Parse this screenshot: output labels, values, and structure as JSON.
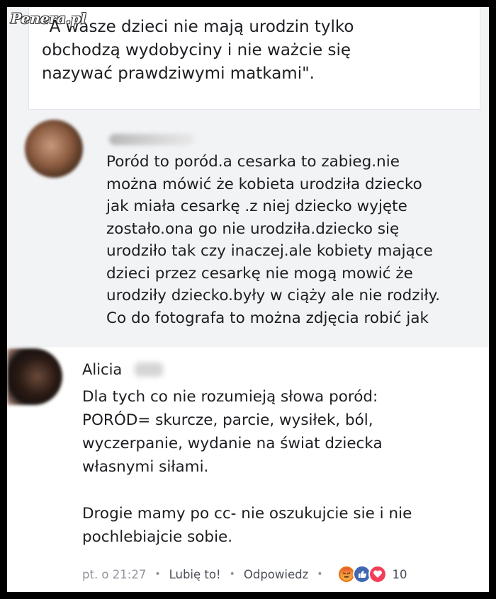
{
  "watermark": "Penera.pl",
  "quote": {
    "text": "\"A wasze dzieci nie mają urodzin tylko\nobchodzą wydobyciny i nie ważcie się\nnazywać prawdziwymi matkami\"."
  },
  "comment1": {
    "text": "Poród to poród.a cesarka to zabieg.nie\nmożna mówić że kobieta urodziła dziecko\njak miała cesarkę .z niej dziecko wyjęte\nzostało.ona go nie urodziła.dziecko się\nurodziło tak czy inaczej.ale kobiety mające\ndzieci przez cesarkę nie mogą mowić że\nurodziły dziecko.były w ciąży ale nie rodziły.\nCo do fotografa to można zdjęcia robić jak"
  },
  "comment2": {
    "author": "Alicia",
    "text": "Dla tych co nie rozumieją słowa poród:\nPORÓD= skurcze, parcie, wysiłek, ból,\nwyczerpanie, wydanie na świat dziecka\nwłasnymi siłami.\n\nDrogie mamy po cc- nie oszukujcie sie i nie\npochlebiajcie sobie.",
    "time": "pt. o 21:27",
    "like_label": "Lubię to!",
    "reply_label": "Odpowiedz",
    "reaction_icons": [
      "angry-icon",
      "like-icon",
      "love-icon"
    ],
    "reaction_count": "10"
  },
  "colors": {
    "link": "#4b4f56",
    "muted": "#90949c",
    "like": "#4267b2",
    "love": "#f33e58",
    "angry": "#e9710f"
  }
}
